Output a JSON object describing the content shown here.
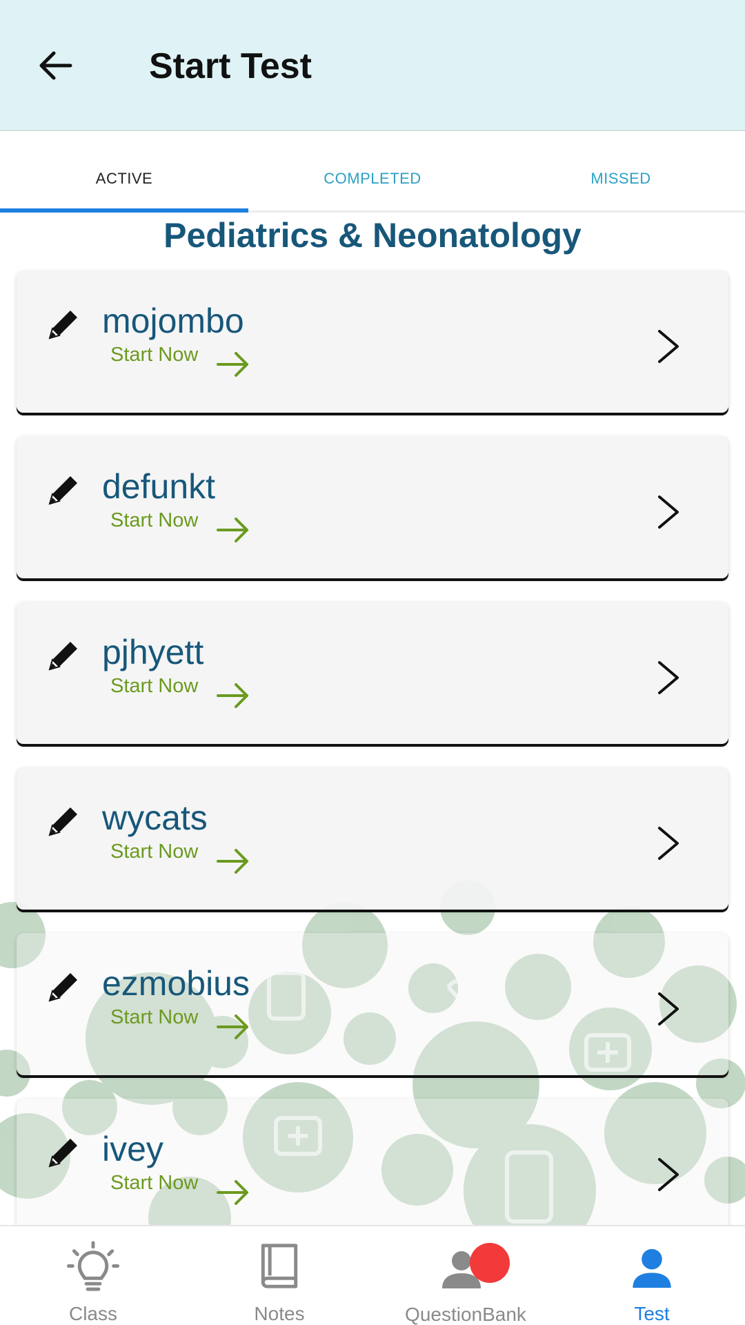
{
  "header": {
    "title": "Start Test",
    "back_icon": "arrow-left-icon"
  },
  "tabs": [
    {
      "label": "ACTIVE",
      "active": true
    },
    {
      "label": "COMPLETED",
      "active": false
    },
    {
      "label": "MISSED",
      "active": false
    }
  ],
  "section_title": "Pediatrics & Neonatology",
  "tests": [
    {
      "name": "mojombo",
      "action": "Start Now"
    },
    {
      "name": "defunkt",
      "action": "Start Now"
    },
    {
      "name": "pjhyett",
      "action": "Start Now"
    },
    {
      "name": "wycats",
      "action": "Start Now"
    },
    {
      "name": "ezmobius",
      "action": "Start Now"
    },
    {
      "name": "ivey",
      "action": "Start Now"
    }
  ],
  "bottom_nav": [
    {
      "label": "Class",
      "icon": "lightbulb-icon",
      "active": false
    },
    {
      "label": "Notes",
      "icon": "book-icon",
      "active": false
    },
    {
      "label": "QuestionBank",
      "icon": "person-icon",
      "active": false,
      "badge": true
    },
    {
      "label": "Test",
      "icon": "person-icon",
      "active": true
    }
  ],
  "colors": {
    "header_bg": "#dff3f6",
    "accent_blue": "#1e7fe0",
    "title_blue": "#17577a",
    "tab_inactive": "#2ba0c6",
    "start_green": "#6b9a1f",
    "badge_red": "#f23a3a",
    "pattern_green": "#b9d1bb"
  }
}
